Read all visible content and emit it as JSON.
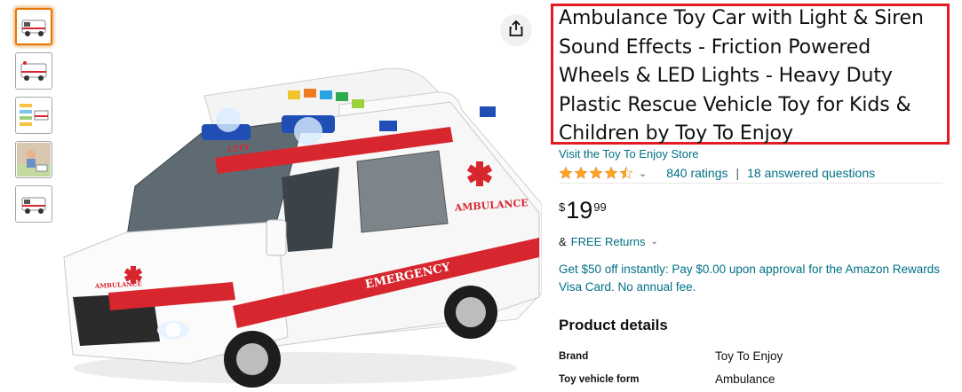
{
  "product": {
    "title": "Ambulance Toy Car with Light & Siren Sound Effects - Friction Powered Wheels & LED Lights - Heavy Duty Plastic Rescue Vehicle Toy for Kids & Children by Toy To Enjoy",
    "store_link": "Visit the Toy To Enjoy Store",
    "rating_value": 4.5,
    "ratings_count": "840 ratings",
    "answered_questions": "18 answered questions",
    "price_symbol": "$",
    "price_whole": "19",
    "price_fraction": "99",
    "returns_prefix": "&",
    "returns_link": "FREE Returns",
    "promo_text": "Get $50 off instantly: Pay $0.00 upon approval for the Amazon Rewards Visa Card. No annual fee."
  },
  "product_details": {
    "heading": "Product details",
    "rows": [
      {
        "key": "Brand",
        "value": "Toy To Enjoy"
      },
      {
        "key": "Toy vehicle form",
        "value": "Ambulance"
      }
    ]
  },
  "image_text": {
    "city": "CITY",
    "emergency": "EMERGENCY",
    "ambulance": "AMBULANCE"
  },
  "thumbnails": [
    "thumb-front",
    "thumb-side",
    "thumb-features",
    "thumb-kid-playing",
    "thumb-front-2"
  ],
  "colors": {
    "link": "#007185",
    "star": "#FFA41C",
    "highlight_border": "#e31b23",
    "ambulance_red": "#d7262e"
  }
}
